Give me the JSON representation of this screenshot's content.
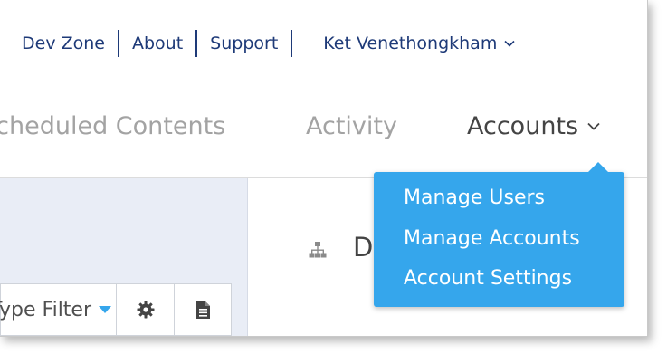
{
  "top_links": {
    "dev_zone": "Dev Zone",
    "about": "About",
    "support": "Support",
    "user_name": "Ket Venethongkham"
  },
  "main_nav": {
    "scheduled_contents": "Scheduled Contents",
    "activity": "Activity",
    "accounts": "Accounts"
  },
  "accounts_menu": {
    "items": [
      "Manage Users",
      "Manage Accounts",
      "Account Settings"
    ],
    "background_color": "#35a6ec"
  },
  "toolbar": {
    "filter_label": "Type Filter"
  },
  "content": {
    "heading_fragment": "D"
  },
  "icons": [
    "chevron-down-icon",
    "caret-down-icon",
    "gear-icon",
    "document-icon",
    "sitemap-icon"
  ],
  "colors": {
    "link": "#1e3a78",
    "accent": "#35a6ec",
    "inactive_tab": "#a3a3a3"
  }
}
